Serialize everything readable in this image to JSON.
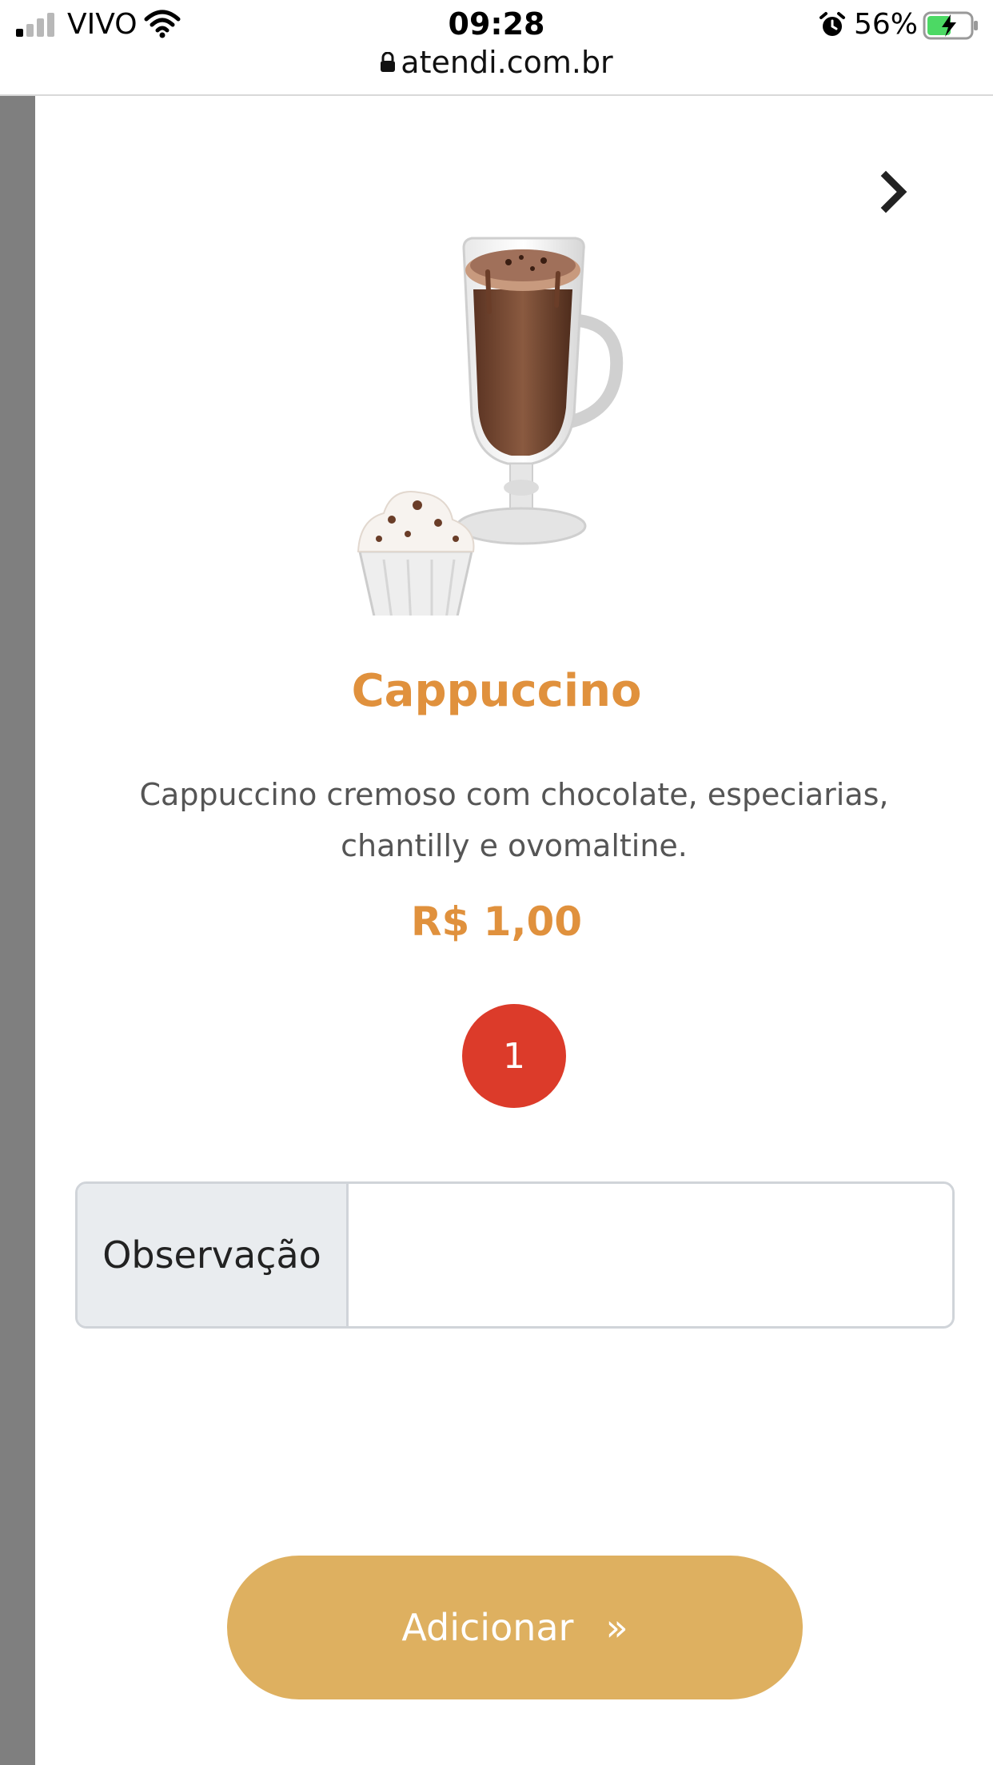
{
  "status_bar": {
    "carrier": "VIVO",
    "time": "09:28",
    "battery_percent": "56%",
    "battery_level": 0.56,
    "url": "atendi.com.br"
  },
  "product": {
    "title": "Cappuccino",
    "description": "Cappuccino cremoso com chocolate, especiarias, chantilly e ovomaltine.",
    "price": "R$ 1,00",
    "quantity": "1"
  },
  "observation": {
    "label": "Observação",
    "value": ""
  },
  "actions": {
    "add_label": "Adicionar",
    "add_icon": "»"
  },
  "colors": {
    "accent": "#e0913d",
    "button": "#deb060",
    "badge": "#dc3b2a"
  }
}
